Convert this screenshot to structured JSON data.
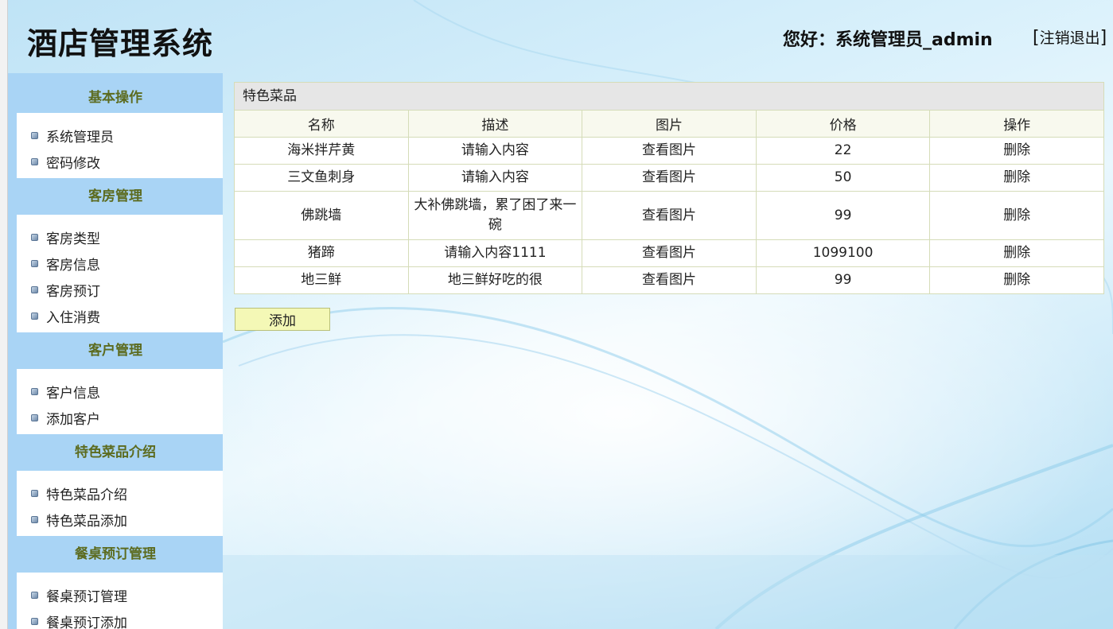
{
  "header": {
    "title": "酒店管理系统",
    "greeting": "您好：系统管理员_admin",
    "logout_label": "注销退出"
  },
  "sidebar": {
    "groups": [
      {
        "title": "基本操作",
        "items": [
          "系统管理员",
          "密码修改"
        ]
      },
      {
        "title": "客房管理",
        "items": [
          "客房类型",
          "客房信息",
          "客房预订",
          "入住消费"
        ]
      },
      {
        "title": "客户管理",
        "items": [
          "客户信息",
          "添加客户"
        ]
      },
      {
        "title": "特色菜品介绍",
        "items": [
          "特色菜品介绍",
          "特色菜品添加"
        ]
      },
      {
        "title": "餐桌预订管理",
        "items": [
          "餐桌预订管理",
          "餐桌预订添加"
        ]
      }
    ]
  },
  "main": {
    "panel_title": "特色菜品",
    "columns": [
      "名称",
      "描述",
      "图片",
      "价格",
      "操作"
    ],
    "rows": [
      {
        "name": "海米拌芹黄",
        "desc": "请输入内容",
        "image": "查看图片",
        "price": "22",
        "action": "删除"
      },
      {
        "name": "三文鱼刺身",
        "desc": "请输入内容",
        "image": "查看图片",
        "price": "50",
        "action": "删除"
      },
      {
        "name": "佛跳墙",
        "desc": "大补佛跳墙，累了困了来一碗",
        "image": "查看图片",
        "price": "99",
        "action": "删除"
      },
      {
        "name": "猪蹄",
        "desc": "请输入内容1111",
        "image": "查看图片",
        "price": "1099100",
        "action": "删除"
      },
      {
        "name": "地三鲜",
        "desc": "地三鲜好吃的很",
        "image": "查看图片",
        "price": "99",
        "action": "删除"
      }
    ],
    "add_label": "添加"
  },
  "colors": {
    "sidebar_bg": "#a9d4f5",
    "group_title_text": "#5c6b1f",
    "table_border": "#d5dcb8",
    "add_button_bg": "#f4f8b6"
  }
}
